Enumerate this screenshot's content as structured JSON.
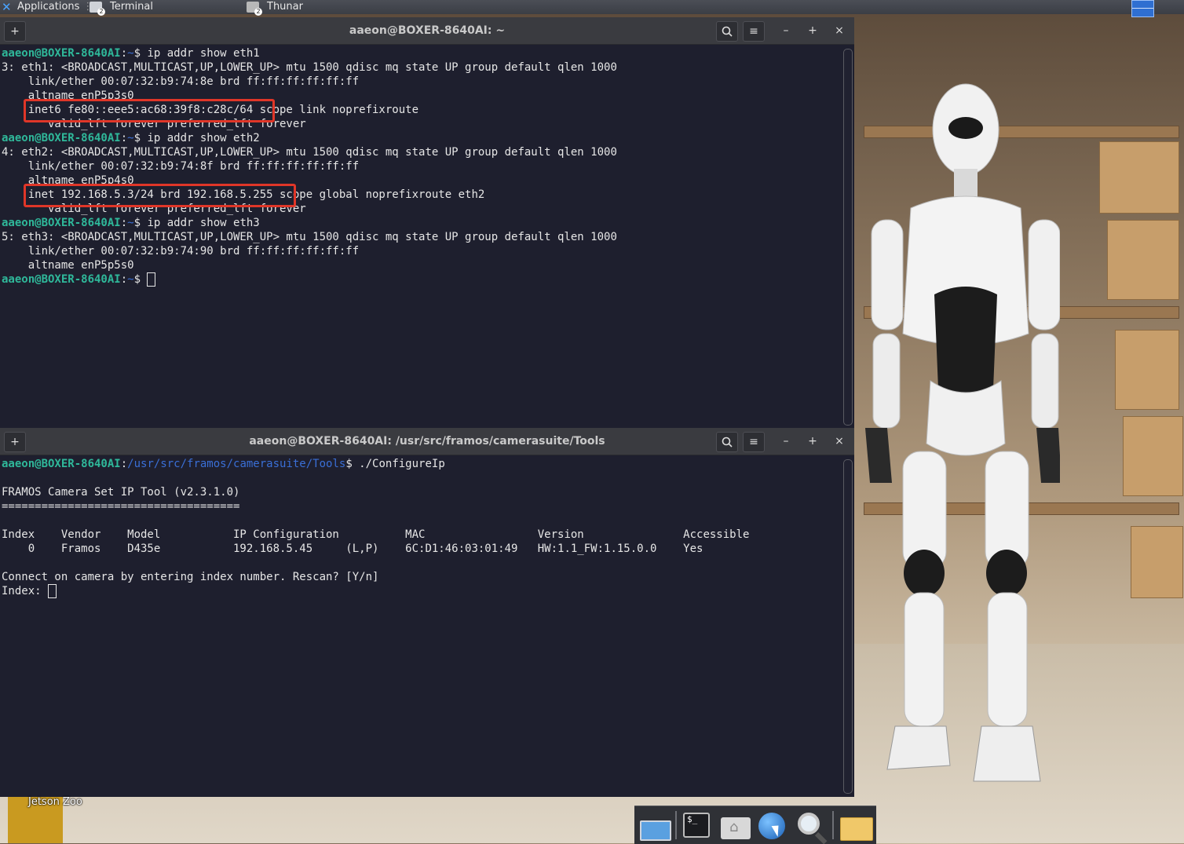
{
  "top_panel": {
    "applications_label": "Applications",
    "terminal_label": "Terminal",
    "terminal_count": "2",
    "thunar_label": "Thunar",
    "thunar_count": "2"
  },
  "terminal_top": {
    "title": "aaeon@BOXER-8640AI: ~",
    "new_tab": "+",
    "minimize": "–",
    "maximize": "+",
    "close": "×",
    "menu": "≡",
    "search": "⌕",
    "lines": [
      {
        "user": "aaeon@BOXER-8640AI",
        "sep": ":",
        "path": "~",
        "cmd": "$ ip addr show eth1"
      },
      {
        "text": "3: eth1: <BROADCAST,MULTICAST,UP,LOWER_UP> mtu 1500 qdisc mq state UP group default qlen 1000"
      },
      {
        "text": "    link/ether 00:07:32:b9:74:8e brd ff:ff:ff:ff:ff:ff"
      },
      {
        "text": "    altname enP5p3s0"
      },
      {
        "text": "    inet6 fe80::eee5:ac68:39f8:c28c/64 scope link noprefixroute"
      },
      {
        "text": "       valid_lft forever preferred_lft forever"
      },
      {
        "user": "aaeon@BOXER-8640AI",
        "sep": ":",
        "path": "~",
        "cmd": "$ ip addr show eth2"
      },
      {
        "text": "4: eth2: <BROADCAST,MULTICAST,UP,LOWER_UP> mtu 1500 qdisc mq state UP group default qlen 1000"
      },
      {
        "text": "    link/ether 00:07:32:b9:74:8f brd ff:ff:ff:ff:ff:ff"
      },
      {
        "text": "    altname enP5p4s0"
      },
      {
        "text": "    inet 192.168.5.3/24 brd 192.168.5.255 scope global noprefixroute eth2"
      },
      {
        "text": "       valid_lft forever preferred_lft forever"
      },
      {
        "user": "aaeon@BOXER-8640AI",
        "sep": ":",
        "path": "~",
        "cmd": "$ ip addr show eth3"
      },
      {
        "text": "5: eth3: <BROADCAST,MULTICAST,UP,LOWER_UP> mtu 1500 qdisc mq state UP group default qlen 1000"
      },
      {
        "text": "    link/ether 00:07:32:b9:74:90 brd ff:ff:ff:ff:ff:ff"
      },
      {
        "text": "    altname enP5p5s0"
      },
      {
        "user": "aaeon@BOXER-8640AI",
        "sep": ":",
        "path": "~",
        "cmd": "$ "
      }
    ]
  },
  "terminal_bottom": {
    "title": "aaeon@BOXER-8640AI: /usr/src/framos/camerasuite/Tools",
    "new_tab": "+",
    "minimize": "–",
    "maximize": "+",
    "close": "×",
    "menu": "≡",
    "search": "⌕",
    "prompt_user": "aaeon@BOXER-8640AI",
    "prompt_sep": ":",
    "prompt_path": "/usr/src/framos/camerasuite/Tools",
    "prompt_cmd": "$ ./ConfigureIp",
    "tool_title": "FRAMOS Camera Set IP Tool (v2.3.1.0)",
    "tool_rule": "====================================",
    "table_header": "Index    Vendor    Model           IP Configuration          MAC                 Version               Accessible",
    "table_row": "    0    Framos    D435e           192.168.5.45     (L,P)    6C:D1:46:03:01:49   HW:1.1_FW:1.15.0.0    Yes",
    "question": "Connect on camera by entering index number. Rescan? [Y/n]",
    "index_prompt": "Index: "
  },
  "desktop": {
    "icon_label": "Jetson Zoo"
  },
  "dock": {
    "terminal_glyph": "$_"
  }
}
